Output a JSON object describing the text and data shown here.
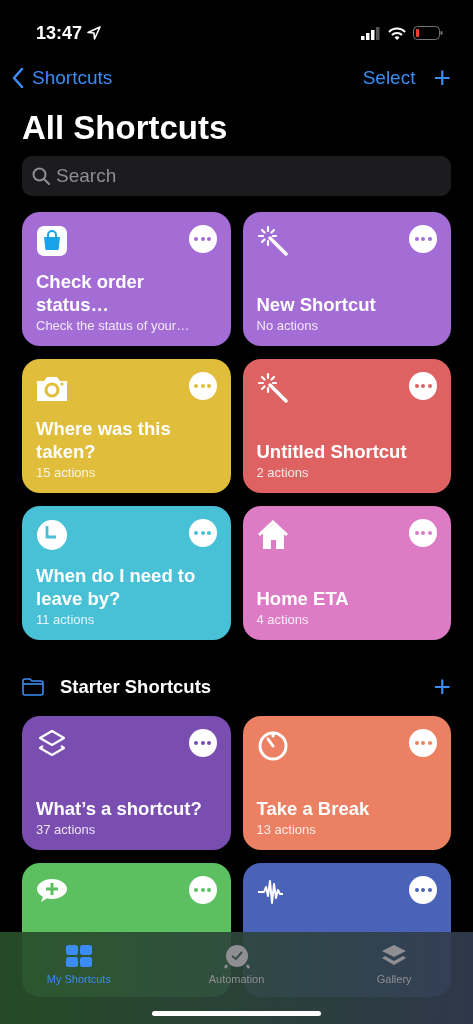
{
  "status_bar": {
    "time": "13:47"
  },
  "nav": {
    "back": "Shortcuts",
    "select": "Select",
    "add": "+"
  },
  "title": "All Shortcuts",
  "search": {
    "placeholder": "Search"
  },
  "shortcuts": [
    {
      "title": "Check order status…",
      "subtitle": "Check the status of your…",
      "color": "#a46dd6"
    },
    {
      "title": "New Shortcut",
      "subtitle": "No actions",
      "color": "#a46dd6"
    },
    {
      "title": "Where was this taken?",
      "subtitle": "15 actions",
      "color": "#e0bd3a"
    },
    {
      "title": "Untitled Shortcut",
      "subtitle": "2 actions",
      "color": "#df6262"
    },
    {
      "title": "When do I need to leave by?",
      "subtitle": "11 actions",
      "color": "#48c0d6"
    },
    {
      "title": "Home ETA",
      "subtitle": "4 actions",
      "color": "#dd7cc4"
    }
  ],
  "folder": {
    "title": "Starter Shortcuts",
    "add": "+"
  },
  "starter_shortcuts": [
    {
      "title": "What’s a shortcut?",
      "subtitle": "37 actions",
      "color": "#7a4db0"
    },
    {
      "title": "Take a Break",
      "subtitle": "13 actions",
      "color": "#ec8062"
    },
    {
      "color": "#5cc061"
    },
    {
      "color": "#4a62b8"
    }
  ],
  "tabs": [
    {
      "label": "My Shortcuts",
      "selected": true
    },
    {
      "label": "Automation",
      "selected": false
    },
    {
      "label": "Gallery",
      "selected": false
    }
  ]
}
